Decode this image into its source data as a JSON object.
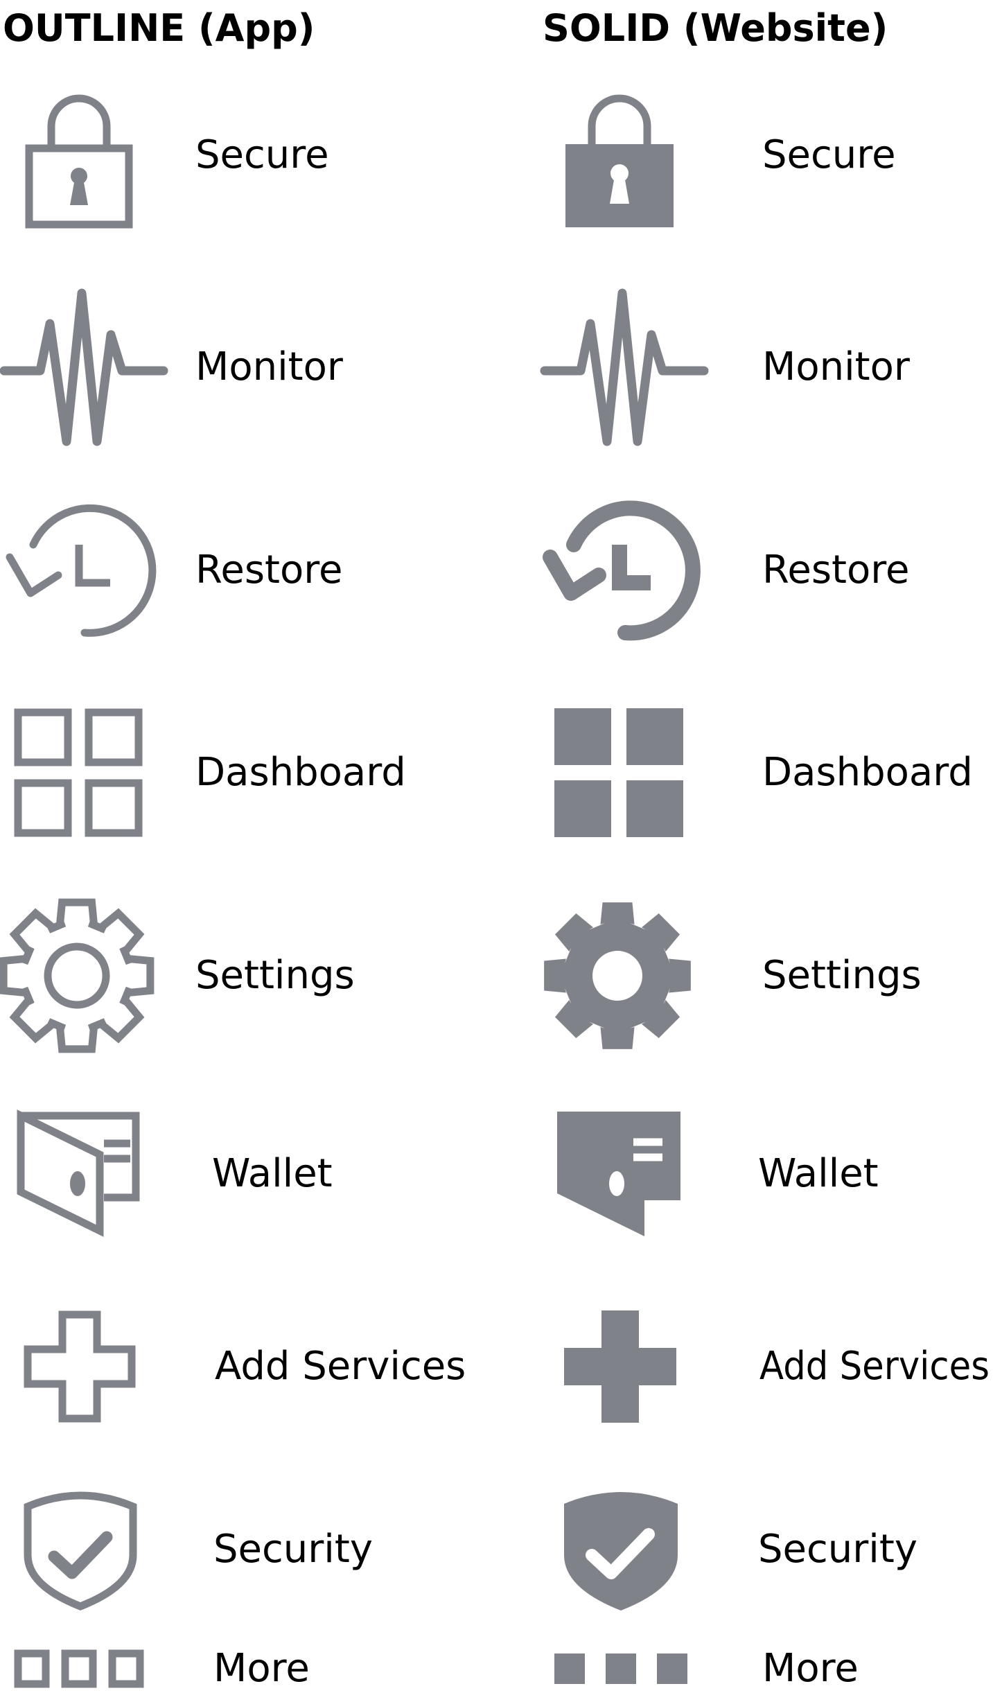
{
  "colors": {
    "icon": "#808289",
    "text": "#000000",
    "background": "#ffffff"
  },
  "columns": [
    {
      "heading": "OUTLINE (App)",
      "style": "outline",
      "items": [
        {
          "label": "Secure",
          "icon": "padlock-icon"
        },
        {
          "label": "Monitor",
          "icon": "pulse-icon"
        },
        {
          "label": "Restore",
          "icon": "history-clock-icon"
        },
        {
          "label": "Dashboard",
          "icon": "grid-icon"
        },
        {
          "label": "Settings",
          "icon": "gear-icon"
        },
        {
          "label": "Wallet",
          "icon": "wallet-icon"
        },
        {
          "label": "Add Services",
          "icon": "plus-icon"
        },
        {
          "label": "Security",
          "icon": "shield-check-icon"
        },
        {
          "label": "More",
          "icon": "more-squares-icon"
        }
      ]
    },
    {
      "heading": "SOLID (Website)",
      "style": "solid",
      "items": [
        {
          "label": "Secure",
          "icon": "padlock-icon"
        },
        {
          "label": "Monitor",
          "icon": "pulse-icon"
        },
        {
          "label": "Restore",
          "icon": "history-clock-icon"
        },
        {
          "label": "Dashboard",
          "icon": "grid-icon"
        },
        {
          "label": "Settings",
          "icon": "gear-icon"
        },
        {
          "label": "Wallet",
          "icon": "wallet-icon"
        },
        {
          "label": "Add Services",
          "icon": "plus-icon"
        },
        {
          "label": "Security",
          "icon": "shield-check-icon"
        },
        {
          "label": "More",
          "icon": "more-squares-icon"
        }
      ]
    }
  ]
}
